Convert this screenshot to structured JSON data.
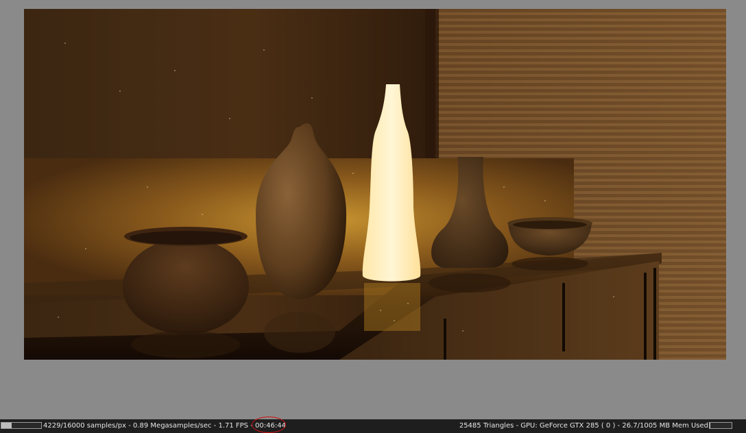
{
  "render": {
    "progress_fraction": 0.264,
    "memory_fraction": 0.027
  },
  "status": {
    "samples": "4229/16000 samples/px",
    "sep1": " - ",
    "megasamples": "0.89 Megasamples/sec",
    "sep2": " - ",
    "fps": "1.71 FPS",
    "sep3": " - ",
    "elapsed": "00:46:44",
    "scene_info": "25485 Triangles - GPU: GeForce GTX 285 ( 0 ) - 26.7/1005 MB Mem Used"
  },
  "colors": {
    "background": "#8a8a8a",
    "statusbar": "#1e1e1e",
    "highlight_circle": "#d01010"
  }
}
